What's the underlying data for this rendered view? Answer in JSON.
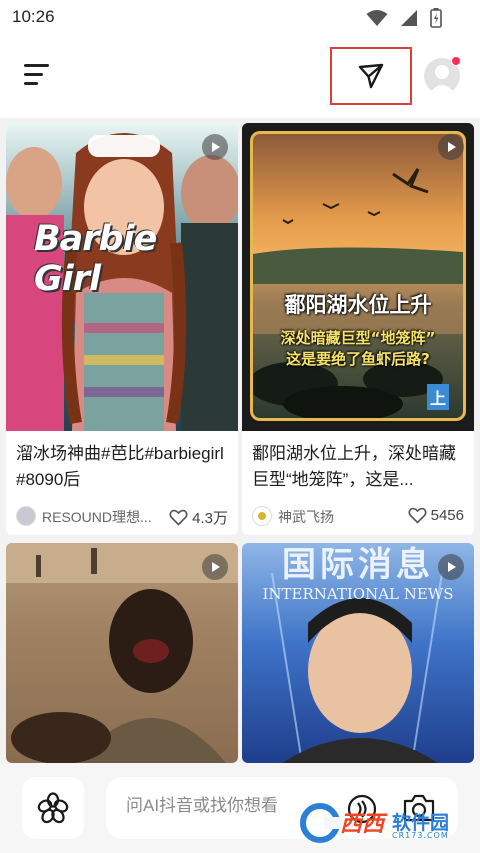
{
  "status_bar": {
    "time": "10:26"
  },
  "feed": [
    {
      "overlay_title": "Barbie Girl",
      "title": "溜冰场神曲#芭比#barbiegirl #8090后",
      "author": "RESOUND理想...",
      "likes": "4.3万"
    },
    {
      "overlay_title": "鄱阳湖水位上升",
      "overlay_subtitle_1": "深处暗藏巨型“地笼阵”",
      "overlay_subtitle_2": "这是要绝了鱼虾后路?",
      "overlay_badge": "上",
      "title": "鄱阳湖水位上升，深处暗藏巨型“地笼阵”，这是...",
      "author": "神武飞扬",
      "likes": "5456"
    },
    {
      "title": "",
      "author": "",
      "likes": ""
    },
    {
      "overlay_title": "国际消息",
      "overlay_subtitle": "INTERNATIONAL NEWS",
      "title": "",
      "author": "",
      "likes": ""
    }
  ],
  "bottom_bar": {
    "search_placeholder": "问AI抖音或找你想看"
  },
  "watermark": {
    "brand": "西西",
    "text": "软件园",
    "sub": "CR173.COM"
  },
  "colors": {
    "highlight_box": "#e0393e",
    "notification_dot": "#ff2d55"
  }
}
